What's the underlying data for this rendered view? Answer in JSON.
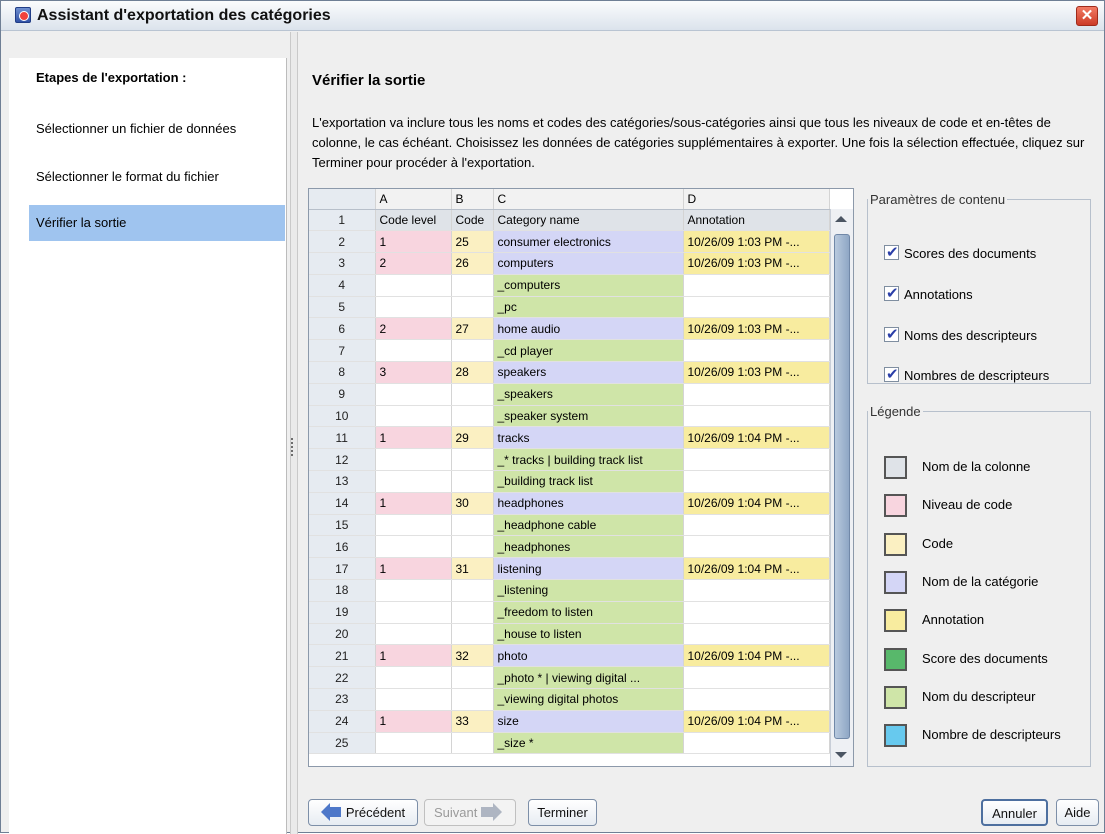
{
  "window": {
    "title": "Assistant d'exportation des catégories",
    "close_label": "✕"
  },
  "sidebar": {
    "heading": "Etapes de l'exportation :",
    "steps": [
      {
        "label": "Sélectionner un fichier de données"
      },
      {
        "label": "Sélectionner le format du fichier"
      },
      {
        "label": "Vérifier la sortie"
      }
    ]
  },
  "main": {
    "title": "Vérifier la sortie",
    "description": "L'exportation va inclure tous les noms et codes des catégories/sous-catégories ainsi que tous les niveaux de code et en-têtes de colonne, le cas échéant. Choisissez les données de catégories supplémentaires à exporter. Une fois la sélection effectuée, cliquez sur Terminer pour procéder à l'exportation."
  },
  "grid": {
    "columns": [
      "",
      "A",
      "B",
      "C",
      "D"
    ],
    "rows": [
      [
        "1",
        "Code level",
        "Code",
        "Category name",
        "Annotation"
      ],
      [
        "2",
        "1",
        "25",
        "consumer electronics",
        "10/26/09 1:03 PM -..."
      ],
      [
        "3",
        "2",
        "26",
        "computers",
        "10/26/09 1:03 PM -..."
      ],
      [
        "4",
        "",
        "",
        "_computers",
        ""
      ],
      [
        "5",
        "",
        "",
        "_pc",
        ""
      ],
      [
        "6",
        "2",
        "27",
        "home audio",
        "10/26/09 1:03 PM -..."
      ],
      [
        "7",
        "",
        "",
        "_cd player",
        ""
      ],
      [
        "8",
        "3",
        "28",
        "speakers",
        "10/26/09 1:03 PM -..."
      ],
      [
        "9",
        "",
        "",
        "_speakers",
        ""
      ],
      [
        "10",
        "",
        "",
        "_speaker system",
        ""
      ],
      [
        "11",
        "1",
        "29",
        "tracks",
        "10/26/09 1:04 PM -..."
      ],
      [
        "12",
        "",
        "",
        "_* tracks | building track list",
        ""
      ],
      [
        "13",
        "",
        "",
        "_building track list",
        ""
      ],
      [
        "14",
        "1",
        "30",
        "headphones",
        "10/26/09 1:04 PM -..."
      ],
      [
        "15",
        "",
        "",
        "_headphone cable",
        ""
      ],
      [
        "16",
        "",
        "",
        "_headphones",
        ""
      ],
      [
        "17",
        "1",
        "31",
        "listening",
        "10/26/09 1:04 PM -..."
      ],
      [
        "18",
        "",
        "",
        "_listening",
        ""
      ],
      [
        "19",
        "",
        "",
        "_freedom to listen",
        ""
      ],
      [
        "20",
        "",
        "",
        "_house to listen",
        ""
      ],
      [
        "21",
        "1",
        "32",
        "photo",
        "10/26/09 1:04 PM -..."
      ],
      [
        "22",
        "",
        "",
        "_photo * | viewing digital ...",
        ""
      ],
      [
        "23",
        "",
        "",
        "_viewing digital photos",
        ""
      ],
      [
        "24",
        "1",
        "33",
        "size",
        "10/26/09 1:04 PM -..."
      ],
      [
        "25",
        "",
        "",
        "_size *",
        ""
      ]
    ]
  },
  "content_settings": {
    "legend": "Paramètres de contenu",
    "items": [
      {
        "label": "Scores des documents",
        "checked": true
      },
      {
        "label": "Annotations",
        "checked": true
      },
      {
        "label": "Noms des descripteurs",
        "checked": true
      },
      {
        "label": "Nombres de descripteurs",
        "checked": true
      }
    ]
  },
  "legend_box": {
    "legend": "Légende",
    "items": [
      {
        "label": "Nom de la colonne",
        "color": "#dfe3e8"
      },
      {
        "label": "Niveau de code",
        "color": "#f8d5df"
      },
      {
        "label": "Code",
        "color": "#fbf0c2"
      },
      {
        "label": "Nom de la catégorie",
        "color": "#d4d6f6"
      },
      {
        "label": "Annotation",
        "color": "#f8ec9f"
      },
      {
        "label": "Score des documents",
        "color": "#58b86b"
      },
      {
        "label": "Nom du descripteur",
        "color": "#cfe5a8"
      },
      {
        "label": "Nombre de descripteurs",
        "color": "#67c9ee"
      }
    ]
  },
  "buttons": {
    "previous": "Précédent",
    "next": "Suivant",
    "finish": "Terminer",
    "cancel": "Annuler",
    "help": "Aide"
  }
}
